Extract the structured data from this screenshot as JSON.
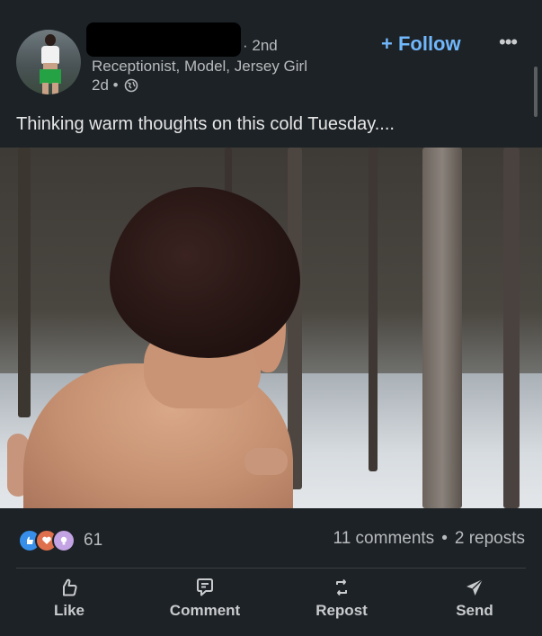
{
  "header": {
    "degree": "· 2nd",
    "headline": "Receptionist, Model, Jersey Girl",
    "time": "2d •",
    "follow_label": "+ Follow",
    "more_label": "•••",
    "visibility_icon": "globe-icon"
  },
  "post": {
    "text": "Thinking warm thoughts on this cold Tuesday...."
  },
  "social": {
    "reaction_icons": [
      "like-icon",
      "love-icon",
      "insightful-icon"
    ],
    "reaction_count": "61",
    "comments": "11 comments",
    "separator": "•",
    "reposts": "2 reposts"
  },
  "actions": {
    "like": "Like",
    "comment": "Comment",
    "repost": "Repost",
    "send": "Send"
  },
  "colors": {
    "background": "#1d2226",
    "accent": "#71b7fb",
    "muted_text": "#b8bbbd"
  }
}
